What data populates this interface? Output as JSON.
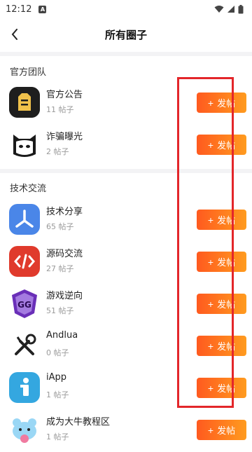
{
  "status_bar": {
    "time": "12:12",
    "notification_badge": "A"
  },
  "header": {
    "title": "所有圈子"
  },
  "sections": [
    {
      "title": "官方团队"
    },
    {
      "title": "技术交流"
    }
  ],
  "items": [
    {
      "name": "官方公告",
      "count": "11 帖子",
      "button": "发帖",
      "icon": "announcement-icon",
      "color": "#f0c14b"
    },
    {
      "name": "诈骗曝光",
      "count": "2 帖子",
      "button": "发帖",
      "icon": "ghost-face-icon",
      "color": "#ffffff"
    },
    {
      "name": "技术分享",
      "count": "65 帖子",
      "button": "发帖",
      "icon": "share-icon",
      "color": "#4a86e8"
    },
    {
      "name": "源码交流",
      "count": "27 帖子",
      "button": "发帖",
      "icon": "code-icon",
      "color": "#e03a2c"
    },
    {
      "name": "游戏逆向",
      "count": "51 帖子",
      "button": "发帖",
      "icon": "game-guardian-icon",
      "color": "#6a2fb8"
    },
    {
      "name": "Andlua",
      "count": "0 帖子",
      "button": "发帖",
      "icon": "tools-icon",
      "color": "#ffffff"
    },
    {
      "name": "iApp",
      "count": "1 帖子",
      "button": "发帖",
      "icon": "iapp-icon",
      "color": "#34a7e0"
    },
    {
      "name": "成为大牛教程区",
      "count": "1 帖子",
      "button": "发帖",
      "icon": "mascot-icon",
      "color": "#9ad7f5"
    }
  ],
  "annotation": {
    "color": "#e3262a"
  }
}
